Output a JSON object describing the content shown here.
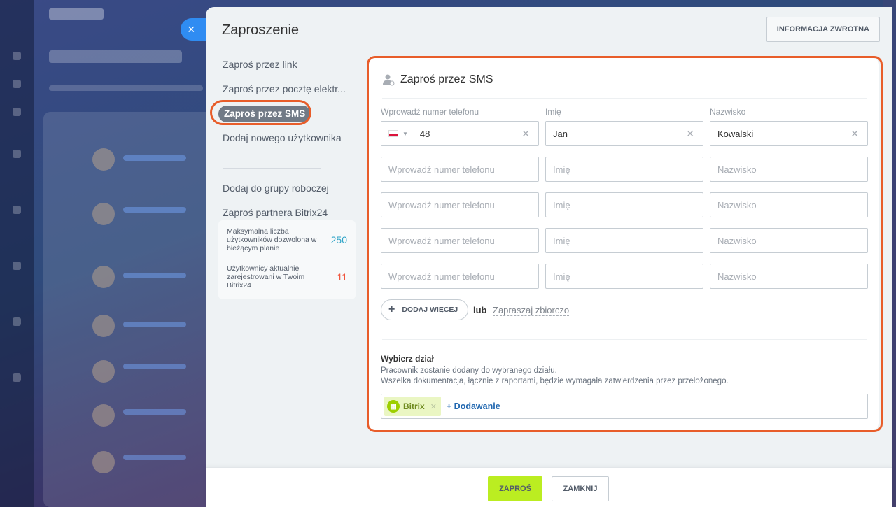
{
  "panel": {
    "title": "Zaproszenie",
    "feedback_label": "INFORMACJA ZWROTNA",
    "close_icon": "×"
  },
  "menu": {
    "items": [
      {
        "label": "Zaproś przez link"
      },
      {
        "label": "Zaproś przez pocztę elektr..."
      },
      {
        "label": "Zaproś przez SMS",
        "active": true
      },
      {
        "label": "Dodaj nowego użytkownika"
      }
    ],
    "items2": [
      {
        "label": "Dodaj do grupy roboczej"
      },
      {
        "label": "Zaproś partnera Bitrix24"
      }
    ]
  },
  "stats": {
    "max_label": "Maksymalna liczba użytkowników dozwolona w bieżącym planie",
    "max_value": "250",
    "current_label": "Użytkownicy aktualnie zarejestrowani w Twoim Bitrix24",
    "current_value": "11"
  },
  "form": {
    "title": "Zaproś przez SMS",
    "col_phone": "Wprowadź numer telefonu",
    "col_name": "Imię",
    "col_surname": "Nazwisko",
    "row1": {
      "phone": "48",
      "name": "Jan",
      "surname": "Kowalski"
    },
    "ph_phone": "Wprowadź numer telefonu",
    "ph_name": "Imię",
    "ph_surname": "Nazwisko",
    "add_more": "DODAJ WIĘCEJ",
    "or": "lub",
    "bulk": "Zapraszaj zbiorczo"
  },
  "department": {
    "title": "Wybierz dział",
    "desc1": "Pracownik zostanie dodany do wybranego działu.",
    "desc2": "Wszelka dokumentacja, łącznie z raportami, będzie wymagała zatwierdzenia przez przełożonego.",
    "tag": "Bitrix",
    "add": "+ Dodawanie"
  },
  "footer": {
    "invite": "ZAPROŚ",
    "close": "ZAMKNIJ"
  },
  "colors": {
    "accent_green": "#bbed21",
    "highlight_ring": "#e85d2a",
    "link_blue": "#2067b0"
  }
}
